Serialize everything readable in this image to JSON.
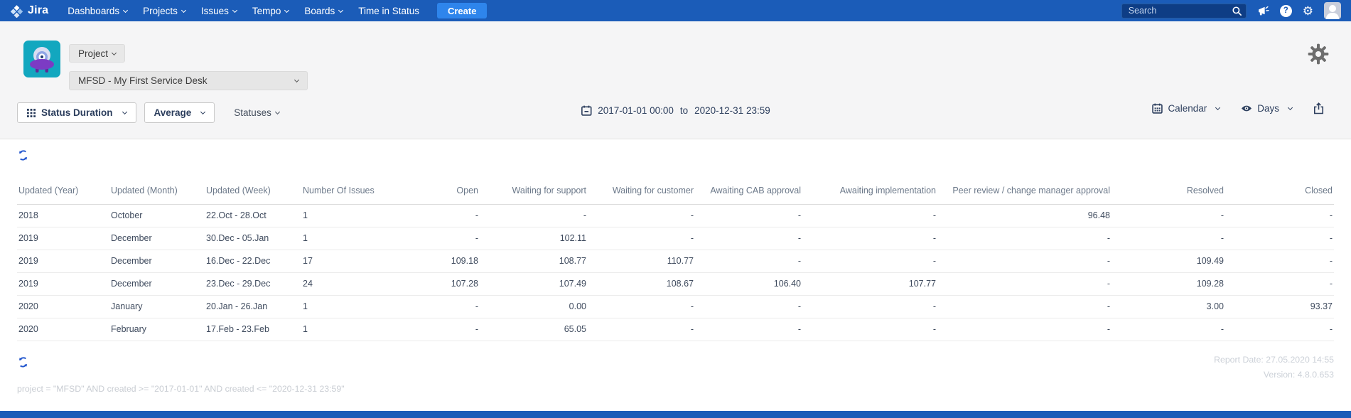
{
  "navbar": {
    "logo_text": "Jira",
    "items": [
      {
        "label": "Dashboards",
        "has_chevron": true
      },
      {
        "label": "Projects",
        "has_chevron": true
      },
      {
        "label": "Issues",
        "has_chevron": true
      },
      {
        "label": "Tempo",
        "has_chevron": true
      },
      {
        "label": "Boards",
        "has_chevron": true
      },
      {
        "label": "Time in Status",
        "has_chevron": false
      }
    ],
    "create_label": "Create",
    "search_placeholder": "Search",
    "help_glyph": "?",
    "colors": {
      "navbar_bg": "#1b5cb8",
      "create_button_bg": "#2e85ec"
    }
  },
  "header": {
    "project_button_label": "Project",
    "project_select_value": "MFSD - My First Service Desk",
    "colors": {
      "project_avatar_teal": "#12a7bf",
      "project_avatar_purple": "#7c3bc4"
    }
  },
  "toolbar": {
    "report_type_label": "Status Duration",
    "metric_label": "Average",
    "statuses_label": "Statuses",
    "date_from": "2017-01-01 00:00",
    "date_separator": "to",
    "date_to": "2020-12-31 23:59",
    "calendar_label": "Calendar",
    "units_label": "Days"
  },
  "table": {
    "columns": [
      "Updated (Year)",
      "Updated (Month)",
      "Updated (Week)",
      "Number Of Issues",
      "Open",
      "Waiting for support",
      "Waiting for customer",
      "Awaiting CAB approval",
      "Awaiting implementation",
      "Peer review / change manager approval",
      "Resolved",
      "Closed"
    ],
    "rows": [
      [
        "2018",
        "October",
        "22.Oct - 28.Oct",
        "1",
        "-",
        "-",
        "-",
        "-",
        "-",
        "96.48",
        "-",
        "-"
      ],
      [
        "2019",
        "December",
        "30.Dec - 05.Jan",
        "1",
        "-",
        "102.11",
        "-",
        "-",
        "-",
        "-",
        "-",
        "-"
      ],
      [
        "2019",
        "December",
        "16.Dec - 22.Dec",
        "17",
        "109.18",
        "108.77",
        "110.77",
        "-",
        "-",
        "-",
        "109.49",
        "-"
      ],
      [
        "2019",
        "December",
        "23.Dec - 29.Dec",
        "24",
        "107.28",
        "107.49",
        "108.67",
        "106.40",
        "107.77",
        "-",
        "109.28",
        "-"
      ],
      [
        "2020",
        "January",
        "20.Jan - 26.Jan",
        "1",
        "-",
        "0.00",
        "-",
        "-",
        "-",
        "-",
        "3.00",
        "93.37"
      ],
      [
        "2020",
        "February",
        "17.Feb - 23.Feb",
        "1",
        "-",
        "65.05",
        "-",
        "-",
        "-",
        "-",
        "-",
        "-"
      ]
    ]
  },
  "footer": {
    "report_date": "Report Date: 27.05.2020 14:55",
    "version": "Version: 4.8.0.653",
    "query": "project = \"MFSD\" AND created >= \"2017-01-01\" AND created <= \"2020-12-31 23:59\""
  }
}
